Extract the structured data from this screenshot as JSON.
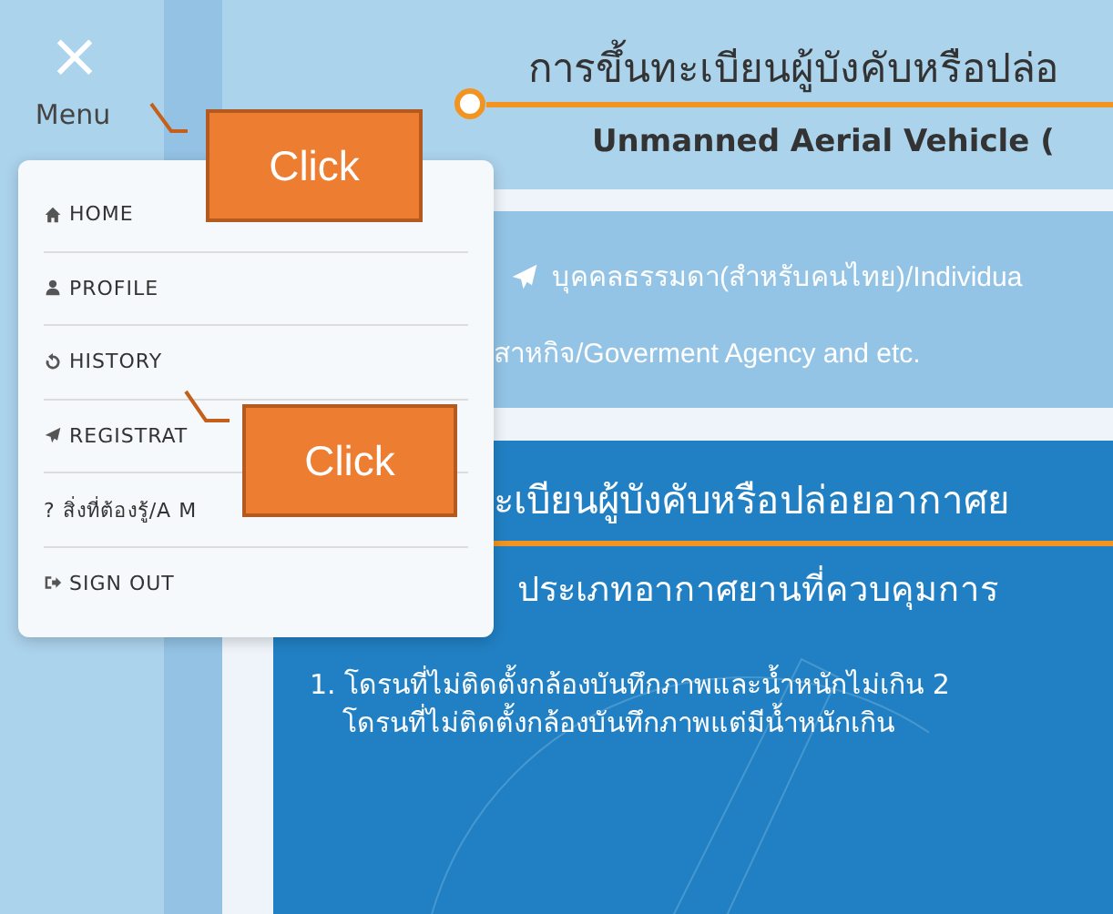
{
  "sidebar": {
    "close": "×",
    "label": "Menu"
  },
  "header": {
    "title": "การขึ้นทะเบียนผู้บังคับหรือปล่อ",
    "subtitle": "Unmanned Aerial Vehicle ("
  },
  "registration": {
    "links": [
      "บุคคลธรรมดา(สำหรับคนไทย)/Individua",
      "สาหกิจ/Goverment Agency and etc."
    ]
  },
  "info_panel": {
    "title": "ะเบียนผู้บังคับหรือปล่อยอากาศย",
    "subtitle": "ประเภทอากาศยานที่ควบคุมการ",
    "lines": [
      "1. โดรนที่ไม่ติดตั้งกล้องบันทึกภาพและน้ำหนักไม่เกิน 2",
      "โดรนที่ไม่ติดตั้งกล้องบันทึกภาพแต่มีน้ำหนักเกิน"
    ]
  },
  "menu": {
    "items": [
      {
        "label": "HOME"
      },
      {
        "label": "PROFILE"
      },
      {
        "label": "HISTORY"
      },
      {
        "label": "REGISTRAT"
      },
      {
        "label": "? สิ่งที่ต้องรู้/A M"
      },
      {
        "label": "SIGN OUT"
      }
    ]
  },
  "callouts": [
    "Click",
    "Click"
  ]
}
